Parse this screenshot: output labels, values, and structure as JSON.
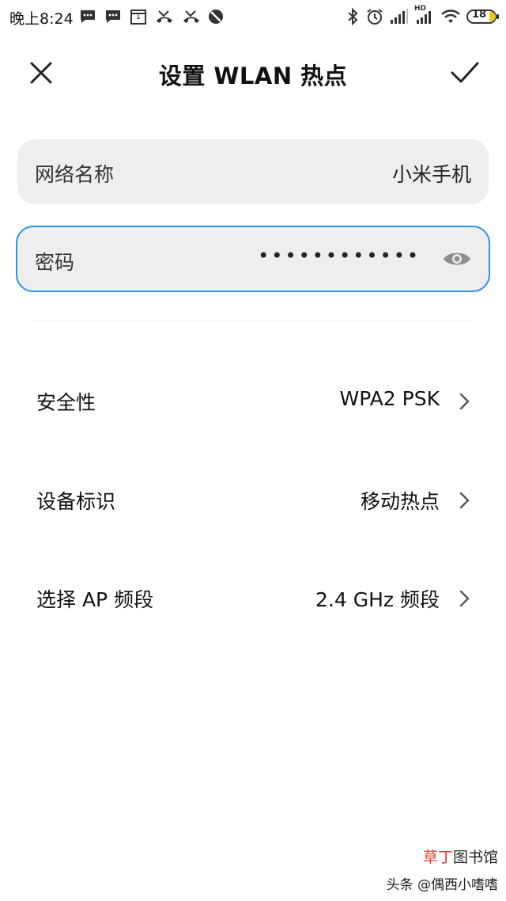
{
  "status_bar": {
    "time": "晚上8:24",
    "hd_label": "HD",
    "battery_level": "18",
    "icons": [
      "message-icon",
      "message-icon",
      "calendar-icon",
      "missed-call-icon",
      "missed-call-icon",
      "do-not-disturb-icon",
      "bluetooth-icon",
      "alarm-icon",
      "signal-icon",
      "signal-hd-icon",
      "wifi-icon",
      "battery-icon"
    ],
    "calendar_day": "1"
  },
  "header": {
    "title": "设置 WLAN 热点",
    "close_icon": "close-icon",
    "confirm_icon": "check-icon"
  },
  "network_name": {
    "label": "网络名称",
    "value": "小米手机"
  },
  "password": {
    "label": "密码",
    "masked_value": "••••••••••••",
    "toggle_icon": "eye-icon",
    "focus_color": "#2c92e8"
  },
  "settings": [
    {
      "label": "安全性",
      "value": "WPA2 PSK"
    },
    {
      "label": "设备标识",
      "value": "移动热点"
    },
    {
      "label": "选择 AP 频段",
      "value": "2.4 GHz 频段"
    }
  ],
  "watermark": {
    "line1_a": "草丁",
    "line1_b": "图书馆",
    "line2": "头条 @偶西小嗜嗜",
    "accent_color": "#e23d2e"
  }
}
